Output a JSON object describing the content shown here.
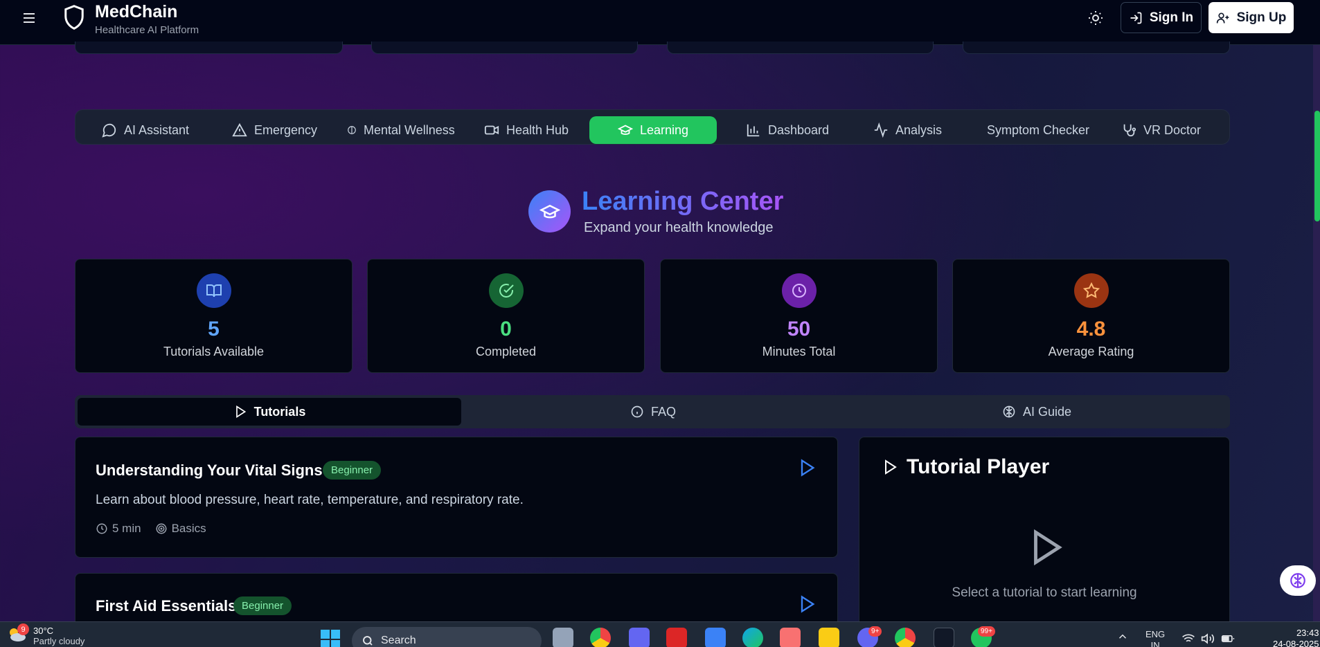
{
  "header": {
    "brand_name": "MedChain",
    "brand_sub": "Healthcare AI Platform",
    "signin_label": "Sign In",
    "signup_label": "Sign Up"
  },
  "feature_tabs": [
    {
      "label": "AI Assistant",
      "icon": "chat-icon"
    },
    {
      "label": "Emergency",
      "icon": "alert-triangle-icon"
    },
    {
      "label": "Mental Wellness",
      "icon": "brain-icon"
    },
    {
      "label": "Health Hub",
      "icon": "video-icon"
    },
    {
      "label": "Learning",
      "icon": "graduation-cap-icon",
      "active": true
    },
    {
      "label": "Dashboard",
      "icon": "bar-chart-icon"
    },
    {
      "label": "Analysis",
      "icon": "activity-icon"
    },
    {
      "label": "Symptom Checker",
      "icon": ""
    },
    {
      "label": "VR Doctor",
      "icon": "stethoscope-icon"
    }
  ],
  "learning": {
    "title": "Learning Center",
    "subtitle": "Expand your health knowledge"
  },
  "stats": [
    {
      "value": "5",
      "label": "Tutorials Available",
      "color": "#60a5fa",
      "icon": "book-open-icon"
    },
    {
      "value": "0",
      "label": "Completed",
      "color": "#4ade80",
      "icon": "check-circle-icon"
    },
    {
      "value": "50",
      "label": "Minutes Total",
      "color": "#c084fc",
      "icon": "clock-icon"
    },
    {
      "value": "4.8",
      "label": "Average Rating",
      "color": "#fb923c",
      "icon": "star-icon"
    }
  ],
  "section_tabs": [
    {
      "label": "Tutorials",
      "active": true
    },
    {
      "label": "FAQ"
    },
    {
      "label": "AI Guide"
    }
  ],
  "tutorials": [
    {
      "title": "Understanding Your Vital Signs",
      "level": "Beginner",
      "description": "Learn about blood pressure, heart rate, temperature, and respiratory rate.",
      "duration": "5 min",
      "category": "Basics"
    },
    {
      "title": "First Aid Essentials",
      "level": "Beginner"
    }
  ],
  "player": {
    "title": "Tutorial Player",
    "hint": "Select a tutorial to start learning"
  },
  "taskbar": {
    "weather_temp": "30°C",
    "weather_desc": "Partly cloudy",
    "weather_badge": "9",
    "search_label": "Search",
    "badge_discord": "9+",
    "badge_whatsapp": "99+",
    "lang": "ENG",
    "lang_sub": "IN",
    "time": "23:43",
    "date": "24-08-2025"
  }
}
